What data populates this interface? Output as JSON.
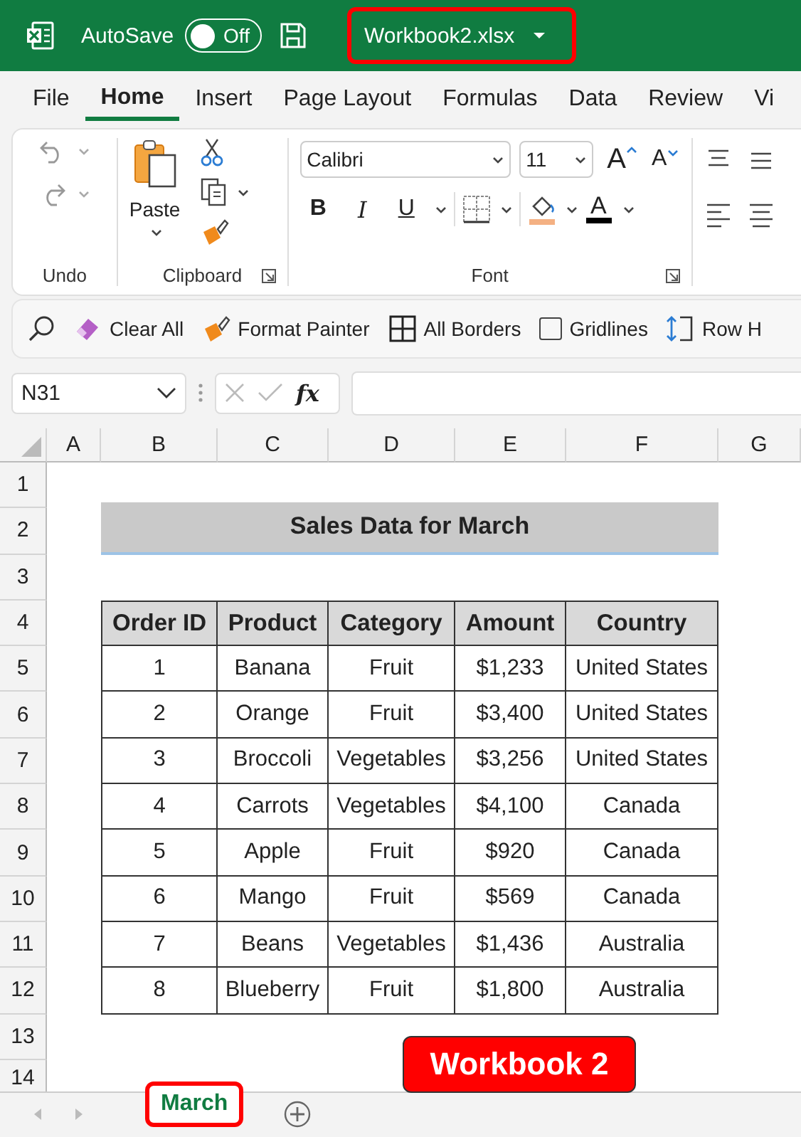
{
  "title_bar": {
    "autosave_label": "AutoSave",
    "autosave_on": false,
    "autosave_state": "Off",
    "file_name": "Workbook2.xlsx",
    "file_highlighted": true
  },
  "menu_tabs": [
    {
      "label": "File",
      "selected": false
    },
    {
      "label": "Home",
      "selected": true
    },
    {
      "label": "Insert",
      "selected": false
    },
    {
      "label": "Page Layout",
      "selected": false
    },
    {
      "label": "Formulas",
      "selected": false
    },
    {
      "label": "Data",
      "selected": false
    },
    {
      "label": "Review",
      "selected": false
    },
    {
      "label": "Vi",
      "selected": false
    }
  ],
  "ribbon": {
    "undo_label": "Undo",
    "paste_label": "Paste",
    "clipboard_label": "Clipboard",
    "font_name": "Calibri",
    "font_size": "11",
    "grow_font": "A",
    "shrink_font": "A",
    "bold": "B",
    "italic": "I",
    "underline": "U",
    "font_color": "A",
    "font_label": "Font"
  },
  "quick_bar": [
    {
      "kind": "button",
      "label": "Clear All"
    },
    {
      "kind": "button",
      "label": "Format Painter"
    },
    {
      "kind": "button",
      "label": "All Borders"
    },
    {
      "kind": "checkbox",
      "label": "Gridlines",
      "checked": false
    },
    {
      "kind": "button",
      "label": "Row H"
    }
  ],
  "formula_bar": {
    "name_box": "N31",
    "function_symbol": "fx"
  },
  "sheet": {
    "columns": [
      "A",
      "B",
      "C",
      "D",
      "E",
      "F",
      "G"
    ],
    "rows": [
      "1",
      "2",
      "3",
      "4",
      "5",
      "6",
      "7",
      "8",
      "9",
      "10",
      "11",
      "12",
      "13",
      "14"
    ],
    "title": "Sales Data for March",
    "table": {
      "header": [
        "Order ID",
        "Product",
        "Category",
        "Amount",
        "Country"
      ],
      "rows": [
        [
          "1",
          "Banana",
          "Fruit",
          "$1,233",
          "United States"
        ],
        [
          "2",
          "Orange",
          "Fruit",
          "$3,400",
          "United States"
        ],
        [
          "3",
          "Broccoli",
          "Vegetables",
          "$3,256",
          "United States"
        ],
        [
          "4",
          "Carrots",
          "Vegetables",
          "$4,100",
          "Canada"
        ],
        [
          "5",
          "Apple",
          "Fruit",
          "$920",
          "Canada"
        ],
        [
          "6",
          "Mango",
          "Fruit",
          "$569",
          "Canada"
        ],
        [
          "7",
          "Beans",
          "Vegetables",
          "$1,436",
          "Australia"
        ],
        [
          "8",
          "Blueberry",
          "Fruit",
          "$1,800",
          "Australia"
        ]
      ]
    }
  },
  "sheet_tabs": [
    {
      "label": "March",
      "selected": true,
      "highlighted": true
    }
  ],
  "callout": "Workbook 2"
}
